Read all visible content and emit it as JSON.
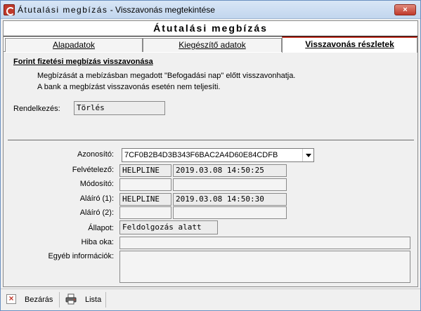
{
  "window": {
    "title_prefix": "Átutalási megbízás",
    "title_suffix": " - Visszavonás megtekintése",
    "close_label": "×"
  },
  "form": {
    "header": "Átutalási megbízás"
  },
  "tabs": [
    {
      "label": "Alapadatok",
      "active": false
    },
    {
      "label": "Kiegészítő adatok",
      "active": false
    },
    {
      "label": "Visszavonás részletek",
      "active": true
    }
  ],
  "section": {
    "title": "Forint fizetési megbízás visszavonása",
    "info_1": "Megbízását a mebízásban megadott \"Befogadási nap\" előtt visszavonhatja.",
    "info_2": "A bank a megbízást visszavonás esetén nem teljesíti."
  },
  "rendelkezes": {
    "label": "Rendelkezés:",
    "value": "Törlés"
  },
  "fields": {
    "azonosito": {
      "label": "Azonosító:",
      "value": "7CF0B2B4D3B343F6BAC2A4D60E84CDFB"
    },
    "felvetelezo": {
      "label": "Felvételező:",
      "user": "HELPLINE",
      "time": "2019.03.08 14:50:25"
    },
    "modosito": {
      "label": "Módosító:",
      "user": "",
      "time": ""
    },
    "alairo1": {
      "label": "Aláíró (1):",
      "user": "HELPLINE",
      "time": "2019.03.08 14:50:30"
    },
    "alairo2": {
      "label": "Aláíró (2):",
      "user": "",
      "time": ""
    },
    "allapot": {
      "label": "Állapot:",
      "value": "Feldolgozás alatt"
    },
    "hiba_oka": {
      "label": "Hiba oka:",
      "value": ""
    },
    "egyeb": {
      "label": "Egyéb információk:",
      "value": ""
    }
  },
  "toolbar": {
    "close_label": "Bezárás",
    "list_label": "Lista"
  },
  "colors": {
    "accent": "#c0392b",
    "title_bar": "#c2d6ee"
  }
}
